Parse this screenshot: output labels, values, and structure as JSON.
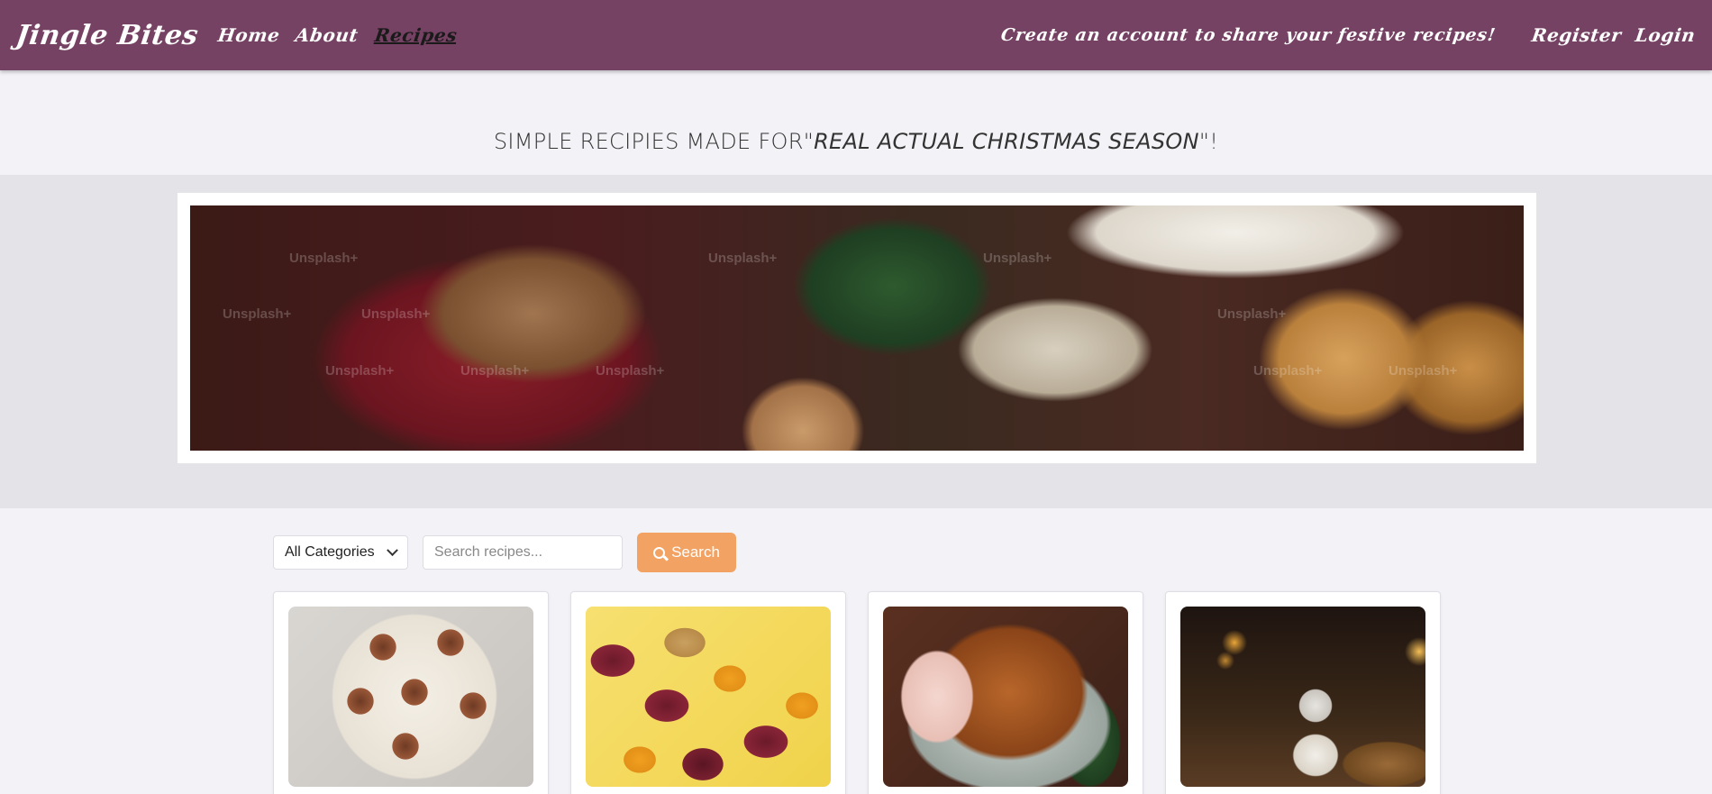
{
  "nav": {
    "brand": "Jingle Bites",
    "links": {
      "home": "Home",
      "about": "About",
      "recipes": "Recipes"
    },
    "promo": "Create an account to share your festive recipes!",
    "register": "Register",
    "login": "Login"
  },
  "headline": {
    "prefix": "SIMPLE RECIPIES MADE FOR\"",
    "emphasis": "REAL ACTUAL CHRISTMAS SEASON",
    "suffix": "\"!"
  },
  "hero": {
    "watermark": "Unsplash+"
  },
  "filters": {
    "category_selected": "All Categories",
    "search_placeholder": "Search recipes...",
    "search_button": "Search"
  },
  "icons": {
    "search": "search-icon",
    "chevron": "chevron-down-icon"
  },
  "colors": {
    "navbar": "#764263",
    "accent_button": "#f2a364",
    "page_background": "#f3f3f7",
    "hero_band": "#e4e3e8"
  }
}
